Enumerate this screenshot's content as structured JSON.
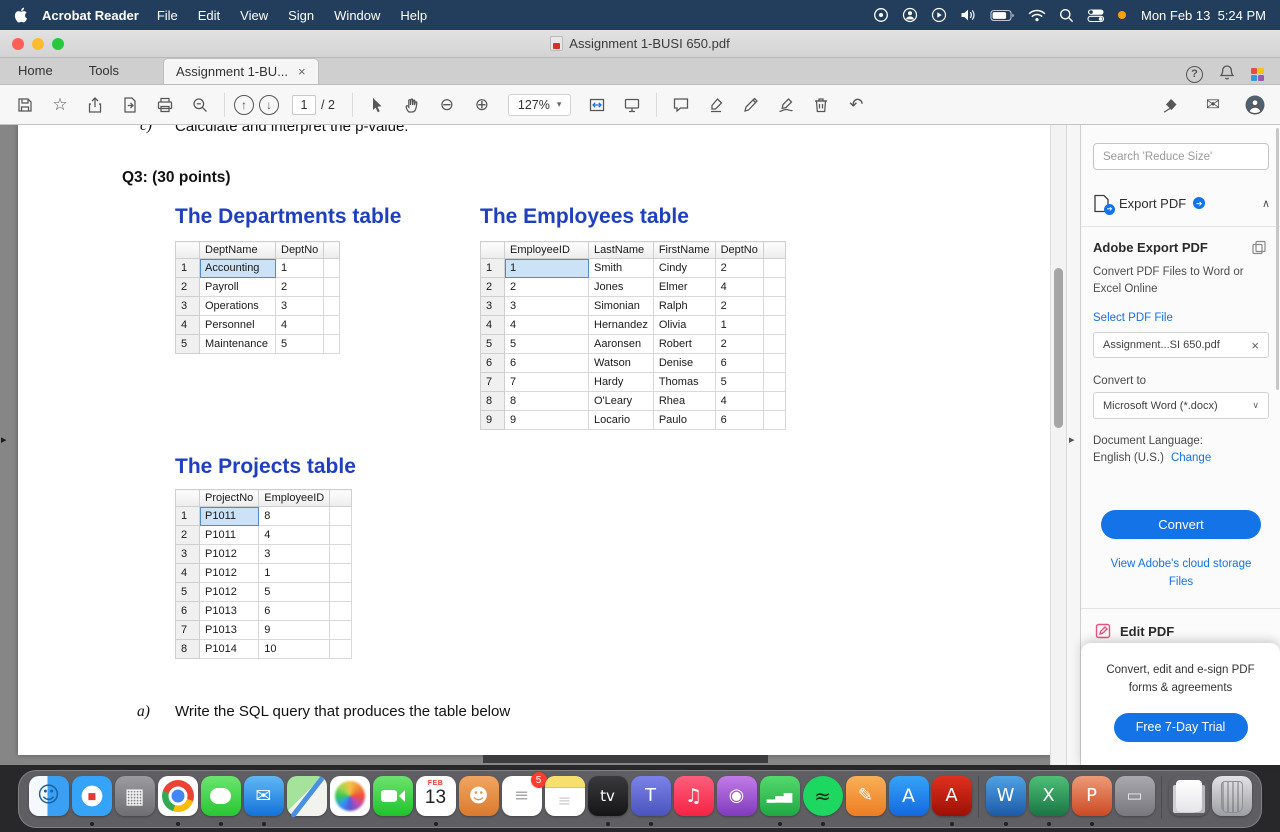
{
  "menubar": {
    "app_name": "Acrobat Reader",
    "items": [
      "File",
      "Edit",
      "View",
      "Sign",
      "Window",
      "Help"
    ],
    "clock": "Mon Feb 13  5:24 PM"
  },
  "titlebar": {
    "title": "Assignment 1-BUSI 650.pdf"
  },
  "tabbar": {
    "home": "Home",
    "tools": "Tools",
    "doc_tab": "Assignment 1-BU...",
    "help": "?"
  },
  "toolbar": {
    "page_current": "1",
    "page_total_label": "/ 2",
    "zoom": "127%"
  },
  "icons": {
    "close": "×",
    "caret_down": "▾",
    "chevron_up": "∧",
    "chevron_down": "∨",
    "star": "☆",
    "zoom_out": "⊖",
    "zoom_in": "⊕",
    "arrow_up": "↑",
    "arrow_down": "↓",
    "envelope": "✉",
    "undo": "↶",
    "expand_right": "▸",
    "mini_arrow": "➔"
  },
  "document": {
    "line_c_label": "c)",
    "line_c_text": "Calculate and interpret the p-value.",
    "q3_heading": "Q3: (30 points)",
    "item_a_label": "a)",
    "item_a_text": "Write the SQL query that produces the table below",
    "departments": {
      "title": "The Departments table",
      "headers": [
        "DeptName",
        "DeptNo"
      ],
      "rows": [
        [
          "1",
          "Accounting",
          "1"
        ],
        [
          "2",
          "Payroll",
          "2"
        ],
        [
          "3",
          "Operations",
          "3"
        ],
        [
          "4",
          "Personnel",
          "4"
        ],
        [
          "5",
          "Maintenance",
          "5"
        ]
      ],
      "selected": [
        0,
        1
      ]
    },
    "employees": {
      "title": "The Employees table",
      "headers": [
        "EmployeeID",
        "LastName",
        "FirstName",
        "DeptNo"
      ],
      "rows": [
        [
          "1",
          "1",
          "Smith",
          "Cindy",
          "2"
        ],
        [
          "2",
          "2",
          "Jones",
          "Elmer",
          "4"
        ],
        [
          "3",
          "3",
          "Simonian",
          "Ralph",
          "2"
        ],
        [
          "4",
          "4",
          "Hernandez",
          "Olivia",
          "1"
        ],
        [
          "5",
          "5",
          "Aaronsen",
          "Robert",
          "2"
        ],
        [
          "6",
          "6",
          "Watson",
          "Denise",
          "6"
        ],
        [
          "7",
          "7",
          "Hardy",
          "Thomas",
          "5"
        ],
        [
          "8",
          "8",
          "O'Leary",
          "Rhea",
          "4"
        ],
        [
          "9",
          "9",
          "Locario",
          "Paulo",
          "6"
        ]
      ],
      "selected": [
        0,
        1
      ]
    },
    "projects": {
      "title": "The Projects table",
      "headers": [
        "ProjectNo",
        "EmployeeID"
      ],
      "rows": [
        [
          "1",
          "P1011",
          "8"
        ],
        [
          "2",
          "P1011",
          "4"
        ],
        [
          "3",
          "P1012",
          "3"
        ],
        [
          "4",
          "P1012",
          "1"
        ],
        [
          "5",
          "P1012",
          "5"
        ],
        [
          "6",
          "P1013",
          "6"
        ],
        [
          "7",
          "P1013",
          "9"
        ],
        [
          "8",
          "P1014",
          "10"
        ]
      ],
      "selected": [
        0,
        1
      ]
    }
  },
  "sidebar": {
    "search_placeholder": "Search 'Reduce Size'",
    "export_pdf": "Export PDF",
    "adobe_export_title": "Adobe Export PDF",
    "adobe_export_desc": "Convert PDF Files to Word or Excel Online",
    "select_pdf_file": "Select PDF File",
    "file_name": "Assignment...SI 650.pdf",
    "convert_to_label": "Convert to",
    "format_value": "Microsoft Word (*.docx)",
    "doc_language_label": "Document Language:",
    "doc_language_value": "English (U.S.)",
    "change_link": "Change",
    "convert_button": "Convert",
    "cloud_link": "View Adobe's cloud storage Files",
    "edit_pdf": "Edit PDF",
    "promo_text": "Convert, edit and e-sign PDF forms & agreements",
    "trial_button": "Free 7-Day Trial"
  },
  "dock": {
    "items": [
      {
        "name": "finder",
        "glyph": "☺",
        "glyph_color": "#1b5f9e",
        "glyph_size": 22,
        "bg": "linear-gradient(90deg,#f5f9fd 0 46%,#3aa0f4 46%)"
      },
      {
        "name": "safari",
        "kind": "safari",
        "glyph": "◆",
        "glyph_color": "#e53935",
        "glyph_size": 13,
        "bg": "radial-gradient(circle,#ffffff 0 36%,#35a3f7 37% 100%)",
        "running": true
      },
      {
        "name": "launchpad",
        "glyph": "▦",
        "glyph_color": "#ffffff",
        "glyph_size": 21,
        "bg": "linear-gradient(180deg,#9b9ba0,#6e6e73)"
      },
      {
        "name": "chrome",
        "kind": "chrome",
        "bg": "#ffffff",
        "running": true
      },
      {
        "name": "messages",
        "kind": "bubble",
        "bg": "linear-gradient(180deg,#6be56f,#27c732)",
        "running": true
      },
      {
        "name": "mail",
        "glyph": "✉",
        "glyph_color": "#ffffff",
        "glyph_size": 19,
        "bg": "linear-gradient(180deg,#5fb7f5,#1472d8)",
        "running": true
      },
      {
        "name": "maps",
        "kind": "maps",
        "bg": "linear-gradient(135deg,#a6e39a 0 45%,#f2f3ee 45%)"
      },
      {
        "name": "photos",
        "kind": "photos",
        "bg": "#ffffff"
      },
      {
        "name": "facetime",
        "kind": "camera",
        "bg": "linear-gradient(180deg,#6ce36f,#1fc32c)"
      },
      {
        "name": "calendar",
        "kind": "calendar",
        "month": "FEB",
        "day": "13",
        "bg": "#ffffff",
        "running": true
      },
      {
        "name": "contacts",
        "glyph": "☻",
        "glyph_color": "#ffffff",
        "glyph_size": 19,
        "bg": "linear-gradient(180deg,#f2a560,#d97a2f)"
      },
      {
        "name": "reminders",
        "glyph": "≡",
        "glyph_color": "#a8a8ad",
        "glyph_size": 18,
        "bg": "#ffffff",
        "badge": "5"
      },
      {
        "name": "notes",
        "kind": "notes",
        "glyph": "≡",
        "glyph_color": "#c9c9c9",
        "glyph_size": 16,
        "bg": "#ffffff"
      },
      {
        "name": "appletv",
        "glyph": "tv",
        "glyph_color": "#ffffff",
        "glyph_size": 15,
        "bg": "linear-gradient(180deg,#3a3a3c,#151517)",
        "running": true
      },
      {
        "name": "teams",
        "glyph": "T",
        "glyph_color": "#ffffff",
        "glyph_size": 18,
        "bg": "linear-gradient(180deg,#7b83eb,#4b53bc)",
        "running": true
      },
      {
        "name": "music",
        "glyph": "♫",
        "glyph_color": "#ffffff",
        "glyph_size": 19,
        "bg": "linear-gradient(180deg,#fc5e7b,#f72343)"
      },
      {
        "name": "podcasts",
        "glyph": "◉",
        "glyph_color": "#ffffff",
        "glyph_size": 18,
        "bg": "linear-gradient(180deg,#c37be8,#7f3bbd)"
      },
      {
        "name": "analytics",
        "glyph": "▂▄▆",
        "glyph_color": "#ffffff",
        "glyph_size": 11,
        "bg": "linear-gradient(180deg,#54d96c,#1fa843)",
        "running": true
      },
      {
        "name": "spotify",
        "glyph": "≈",
        "glyph_color": "#0a2812",
        "glyph_size": 20,
        "bg": "#1ed760",
        "round": true,
        "running": true
      },
      {
        "name": "pages",
        "glyph": "✎",
        "glyph_color": "#ffffff",
        "glyph_size": 18,
        "bg": "linear-gradient(180deg,#f9b057,#ed7d23)"
      },
      {
        "name": "appstore",
        "glyph": "A",
        "glyph_color": "#ffffff",
        "glyph_size": 19,
        "bg": "linear-gradient(180deg,#35a3f7,#1468e0)"
      },
      {
        "name": "acrobat",
        "glyph": "A",
        "glyph_color": "#ffffff",
        "glyph_size": 18,
        "bg": "linear-gradient(180deg,#e0301e,#9c1006)",
        "running": true,
        "sep_after": true
      },
      {
        "name": "word",
        "glyph": "W",
        "glyph_color": "#ffffff",
        "glyph_size": 18,
        "bg": "linear-gradient(180deg,#4fa3e3,#1d59a8)",
        "running": true
      },
      {
        "name": "excel",
        "glyph": "X",
        "glyph_color": "#ffffff",
        "glyph_size": 18,
        "bg": "linear-gradient(180deg,#4ebf77,#1a7544)",
        "running": true
      },
      {
        "name": "powerpoint",
        "glyph": "P",
        "glyph_color": "#ffffff",
        "glyph_size": 18,
        "bg": "linear-gradient(180deg,#ee9a77,#cb4a24)",
        "running": true
      },
      {
        "name": "system-display",
        "glyph": "▭",
        "glyph_color": "#e8e8ec",
        "glyph_size": 17,
        "bg": "linear-gradient(180deg,#a9a9af,#77777d)",
        "sep_after": true
      },
      {
        "name": "downloads-stack",
        "kind": "stack",
        "bg": "transparent"
      },
      {
        "name": "trash",
        "kind": "trash",
        "bg": "linear-gradient(180deg,#e3e3e6,#9d9da3)"
      }
    ]
  }
}
